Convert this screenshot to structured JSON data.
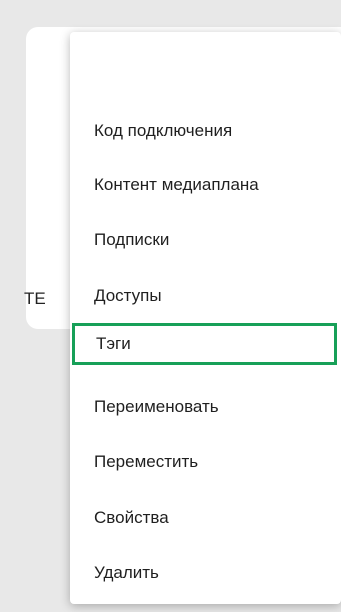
{
  "background_card": {
    "label": "ТЕ"
  },
  "context_menu": {
    "items": [
      {
        "label": "Код подключения"
      },
      {
        "label": "Контент медиаплана"
      },
      {
        "label": "Подписки"
      },
      {
        "label": "Доступы"
      },
      {
        "label": "Тэги",
        "highlighted": true
      },
      {
        "label": "Переименовать"
      },
      {
        "label": "Переместить"
      },
      {
        "label": "Свойства"
      },
      {
        "label": "Удалить"
      }
    ]
  },
  "colors": {
    "highlight_border": "#17a058",
    "page_background": "#e8e8e8",
    "card_background": "#ffffff"
  }
}
